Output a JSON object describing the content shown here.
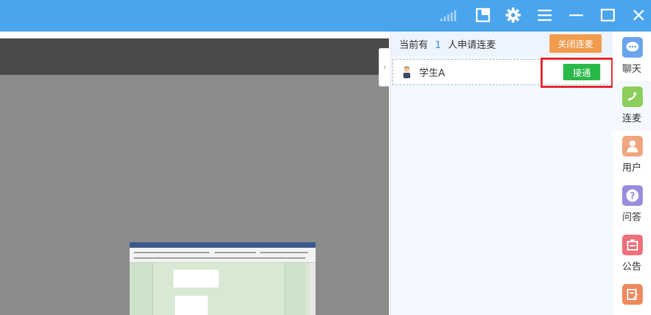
{
  "colors": {
    "titlebar": "#4aa4ee",
    "video_bg": "#8c8c8c",
    "panel_bg": "#f4f8ff",
    "close_button": "#f39b4c",
    "accept_button": "#29b94a",
    "count_text": "#2d8ce8",
    "highlight": "#e32226"
  },
  "titlebar": {
    "icons": [
      "signal-icon",
      "window-snap-icon",
      "settings-icon",
      "menu-icon",
      "minimize-icon",
      "maximize-icon",
      "close-icon"
    ]
  },
  "request_panel": {
    "prefix": "当前有",
    "count": "1",
    "suffix": "人申请连麦",
    "close_button": "关闭连麦",
    "requests": [
      {
        "name": "学生A",
        "accept_button": "接通"
      }
    ]
  },
  "sidebar": {
    "items": [
      {
        "label": "聊天",
        "icon": "chat-icon",
        "color": "#6aa4ee"
      },
      {
        "label": "连麦",
        "icon": "phone-icon",
        "color": "#8ccf5a"
      },
      {
        "label": "用户",
        "icon": "user-icon",
        "color": "#f0a57e"
      },
      {
        "label": "问答",
        "icon": "question-icon",
        "color": "#9b8be0"
      },
      {
        "label": "公告",
        "icon": "notice-icon",
        "color": "#ef6f7a"
      },
      {
        "label": "",
        "icon": "edit-icon",
        "color": "#f08a5e"
      }
    ],
    "active_index": 1
  }
}
